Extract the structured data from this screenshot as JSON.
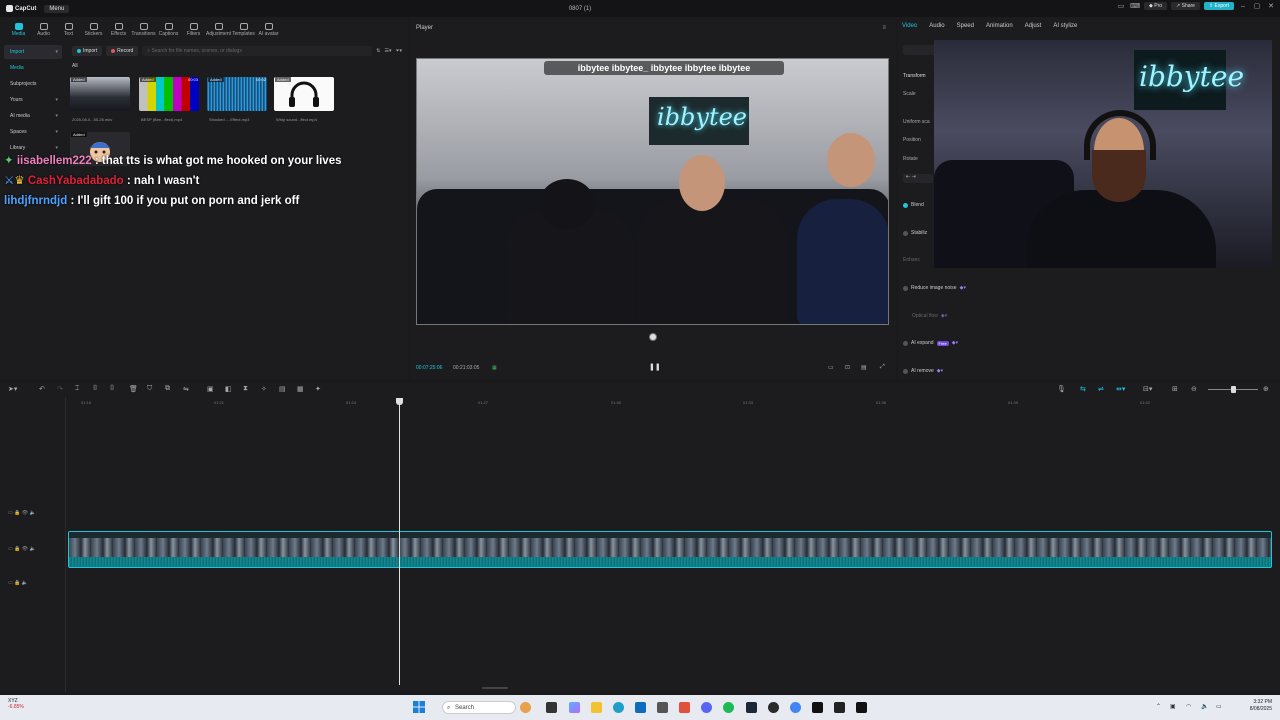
{
  "titlebar": {
    "app_name": "CapCut",
    "menu_label": "Menu",
    "project_title": "0807 (1)",
    "pro_label": "Pro",
    "share_label": "Share",
    "export_label": "Export",
    "minimize": "–",
    "maximize": "▢",
    "close": "✕"
  },
  "toptabs": [
    {
      "label": "Media",
      "icon": "media-icon"
    },
    {
      "label": "Audio",
      "icon": "audio-icon"
    },
    {
      "label": "Text",
      "icon": "text-icon"
    },
    {
      "label": "Stickers",
      "icon": "stickers-icon"
    },
    {
      "label": "Effects",
      "icon": "effects-icon"
    },
    {
      "label": "Transitions",
      "icon": "transitions-icon"
    },
    {
      "label": "Captions",
      "icon": "captions-icon"
    },
    {
      "label": "Filters",
      "icon": "filters-icon"
    },
    {
      "label": "Adjustment",
      "icon": "adjustment-icon"
    },
    {
      "label": "Templates",
      "icon": "templates-icon"
    },
    {
      "label": "AI avatar",
      "icon": "ai-avatar-icon"
    }
  ],
  "sidebar": {
    "items": [
      {
        "label": "Import"
      },
      {
        "label": "Media"
      },
      {
        "label": "Subprojects"
      },
      {
        "label": "Yours"
      },
      {
        "label": "AI media"
      },
      {
        "label": "Spaces"
      },
      {
        "label": "Library"
      }
    ]
  },
  "mediabar": {
    "import_label": "Import",
    "record_label": "Record",
    "search_placeholder": "Search for file names, scenes, or dialogs"
  },
  "media": {
    "filter_label": "All",
    "items": [
      {
        "tag": "Added",
        "duration": "",
        "name": "2025-08-0...55-26.mkv"
      },
      {
        "tag": "Added",
        "duration": "00:03",
        "name": "BESP (Bee...ffect).mp4"
      },
      {
        "tag": "Added",
        "duration": "00:02",
        "name": "Shocked -...Effect.mp3"
      },
      {
        "tag": "Added",
        "duration": "",
        "name": "Whip sound...ffect.mp4"
      },
      {
        "tag": "Added",
        "duration": "",
        "name": ""
      }
    ]
  },
  "chat": [
    {
      "user": "iisabellem222",
      "message": ": that tts is what got me hooked on your lives"
    },
    {
      "user": "CashYabadabado",
      "message": ": nah I wasn't"
    },
    {
      "user": "lihdjfnrndjd",
      "message": ": I'll gift 100 if you put on porn and jerk off"
    }
  ],
  "player": {
    "label": "Player",
    "overlay_text": "ibbytee ibbytee_ ibbytee ibbytee ibbytee",
    "neon_sign": "ibbytee",
    "current_time": "00:07:25:06",
    "total_time": "00:21:03:05"
  },
  "rightpanel": {
    "tabs": [
      "Video",
      "Audio",
      "Speed",
      "Animation",
      "Adjust",
      "AI stylize"
    ],
    "transform_label": "Transform",
    "scale_label": "Scale",
    "uniform_label": "Uniform sca",
    "position_label": "Position",
    "rotate_label": "Rotate",
    "blend_label": "Blend",
    "stabilize_label": "Stabiliz",
    "enhance_label": "Enhanc",
    "reduce_noise_label": "Reduce image noise",
    "optical_flow_label": "Optical flow",
    "ai_expand_label": "AI expand",
    "new_badge": "Free",
    "ai_remove_label": "AI remove",
    "cam_neon": "ibbytee"
  },
  "timeline": {
    "ticks": [
      "01:18",
      "01:21",
      "01:24",
      "01:27",
      "01:30",
      "01:33",
      "01:36",
      "01:39",
      "01:42"
    ]
  },
  "taskbar": {
    "stock_name": "XYZ",
    "stock_change": "-6.85%",
    "search_label": "Search",
    "time": "3:32 PM",
    "date": "8/08/2025"
  }
}
